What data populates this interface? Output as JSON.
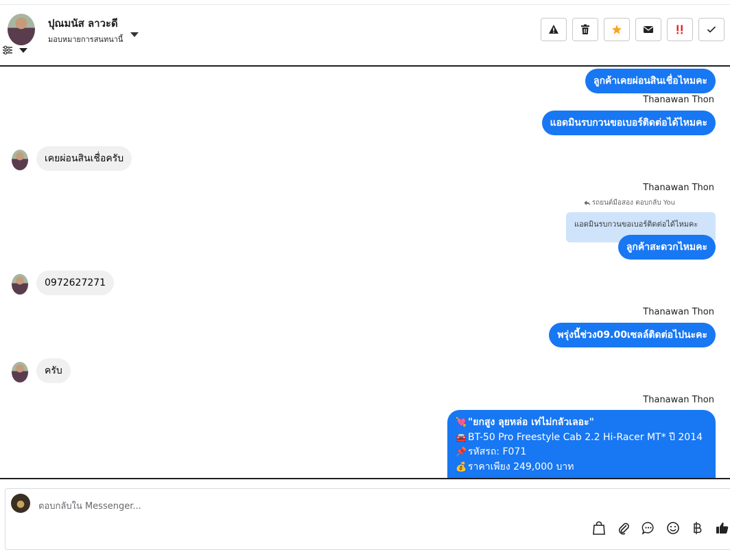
{
  "header": {
    "user_name": "ปุณมนัส ลาวะดี",
    "assign_label": "มอบหมายการสนทนานี้",
    "actions": [
      "alert-icon",
      "trash-icon",
      "star-icon",
      "envelope-icon",
      "urgent-icon",
      "check-icon"
    ],
    "colors": {
      "star": "#f5a623",
      "urgent": "#e02020"
    }
  },
  "messages": {
    "m1": "ลูกค้าเคยผ่อนสินเชื่อไหมคะ",
    "sender1": "Thanawan Thon",
    "m2": "แอดมินรบกวนขอเบอร์ติดต่อได้ไหมคะ",
    "m3": "เคยผ่อนสินเชื่อครับ",
    "sender2": "Thanawan Thon",
    "reply_meta": "รถยนต์มือสอง ตอบกลับ You",
    "quote": "แอดมินรบกวนขอเบอร์ติดต่อได้ไหมคะ",
    "m4": "ลูกค้าสะดวกไหมคะ",
    "m5": "0972627271",
    "sender3": "Thanawan Thon",
    "m6": "พรุ่งนี้ช่วง09.00เซลล์ติดต่อไปนะคะ",
    "m7": "ครับ",
    "sender4": "Thanawan Thon",
    "big": {
      "line1": "\"ยกสูง ลุยหล่อ เท่ไม่กลัวเลอะ\"",
      "line2": "BT-50 Pro Freestyle Cab 2.2 Hi-Racer MT* ปี 2014",
      "line3": "รหัสรถ: F071",
      "line4": "ราคาเพียง 249,000 บาท",
      "emoji1": "💘",
      "emoji2": "🚘",
      "emoji3": "📌",
      "emoji4": "💰"
    }
  },
  "composer": {
    "placeholder": "ตอบกลับใน Messenger..."
  },
  "accent_color": "#1877f2"
}
